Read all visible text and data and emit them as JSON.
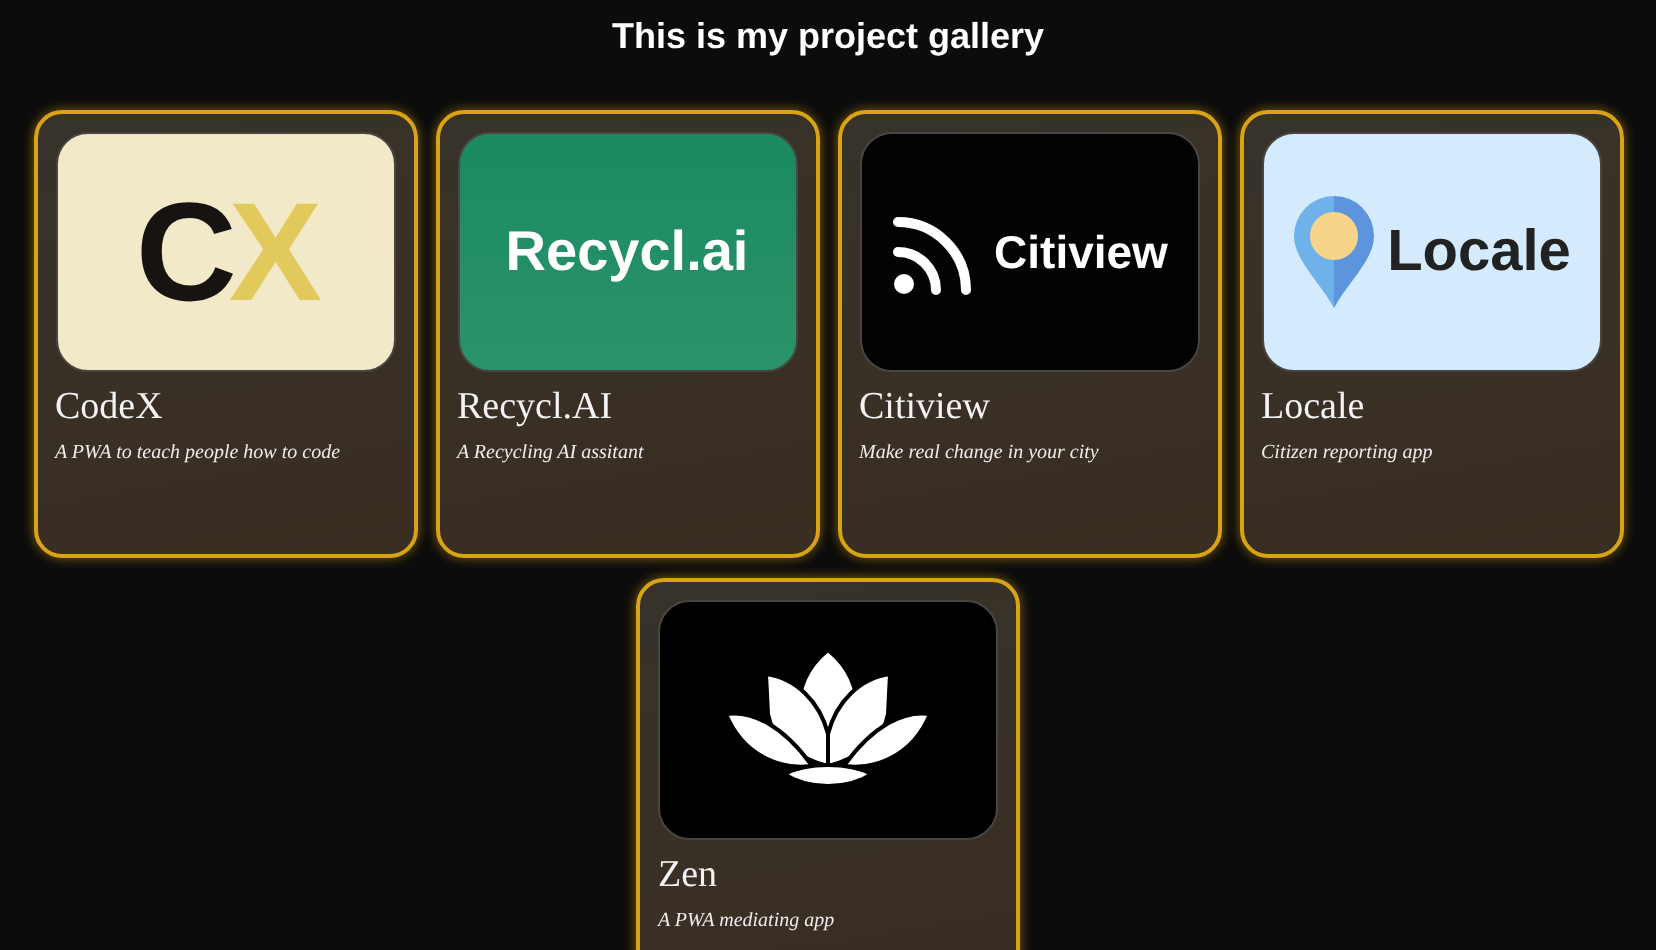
{
  "title": "This is my project gallery",
  "projects": [
    {
      "name": "CodeX",
      "description": "A PWA to teach people how to code",
      "logo": {
        "kind": "codex",
        "parts": [
          {
            "text": "C",
            "color": "#161310"
          },
          {
            "text": "X",
            "color": "#e2c95c"
          }
        ]
      }
    },
    {
      "name": "Recycl.AI",
      "description": "A Recycling AI assitant",
      "logo": {
        "kind": "recycl",
        "parts": [
          {
            "text": "Recycl.ai",
            "color": "#ffffff"
          }
        ]
      }
    },
    {
      "name": "Citiview",
      "description": "Make real change in your city",
      "logo": {
        "kind": "citiview",
        "parts": [
          {
            "text": "Citiview",
            "color": "#ffffff"
          }
        ]
      }
    },
    {
      "name": "Locale",
      "description": "Citizen reporting app",
      "logo": {
        "kind": "locale",
        "parts": [
          {
            "text": "Locale",
            "color": "#222222"
          }
        ]
      }
    },
    {
      "name": "Zen",
      "description": "A PWA mediating app",
      "logo": {
        "kind": "zen"
      }
    }
  ]
}
